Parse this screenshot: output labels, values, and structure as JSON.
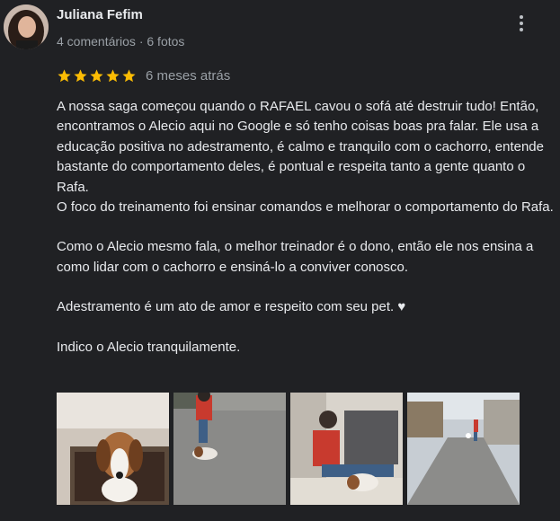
{
  "reviewer": {
    "name": "Juliana Fefim",
    "meta": "4 comentários · 6 fotos"
  },
  "review": {
    "rating": 5,
    "max_rating": 5,
    "time": "6 meses atrás",
    "paragraphs": [
      "A nossa saga começou quando o RAFAEL cavou o sofá até destruir tudo! Então, encontramos o Alecio aqui no Google e só tenho coisas boas pra falar. Ele usa a educação positiva no adestramento, é calmo e tranquilo com o cachorro, entende bastante do comportamento deles, é pontual e respeita tanto a gente quanto o Rafa.",
      "O foco do treinamento foi ensinar comandos e melhorar o comportamento do Rafa.",
      "Como o Alecio mesmo fala, o melhor treinador é o dono, então ele nos ensina a como lidar com o cachorro e ensiná-lo a conviver conosco.",
      "Adestramento é um ato de amor e respeito com seu pet. ♥",
      "Indico o Alecio tranquilamente."
    ]
  },
  "colors": {
    "background": "#202124",
    "star": "#fbbc04",
    "secondary_text": "#9aa0a6"
  },
  "icons": {
    "menu": "more-vert-icon",
    "star": "star-icon"
  }
}
